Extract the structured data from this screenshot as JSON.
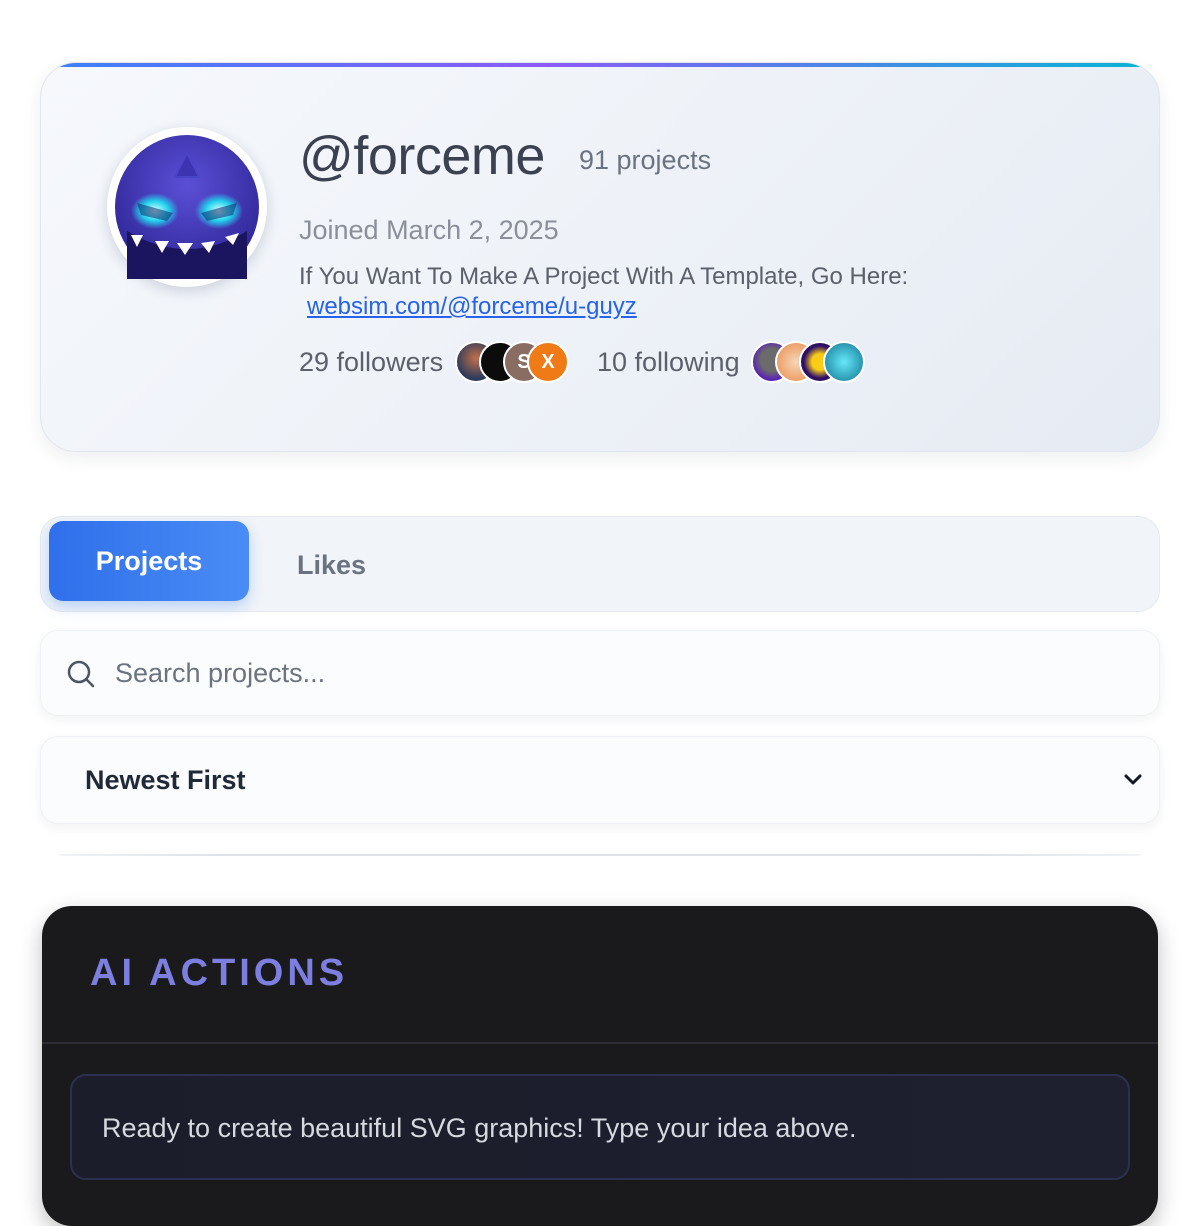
{
  "profile": {
    "username": "@forceme",
    "project_count": "91 projects",
    "joined": "Joined March 2, 2025",
    "bio": "If You Want To Make A Project With A Template, Go Here:",
    "bio_link": "websim.com/@forceme/u-guyz",
    "followers": "29 followers",
    "following": "10 following",
    "follower_avatars": [
      "avatar-photo",
      "avatar-dark",
      "avatar-s",
      "avatar-x"
    ],
    "following_avatars": [
      "avatar-purple",
      "avatar-peach",
      "avatar-yellow",
      "avatar-teal"
    ]
  },
  "tabs": [
    {
      "label": "Projects",
      "active": true
    },
    {
      "label": "Likes",
      "active": false
    }
  ],
  "search": {
    "placeholder": "Search projects...",
    "value": ""
  },
  "sort": {
    "selected": "Newest First"
  },
  "ai_actions": {
    "title": "AI ACTIONS",
    "status": "Ready to create beautiful SVG graphics! Type your idea above."
  },
  "colors": {
    "accent": "#3b82f6",
    "ai_title": "#7c7fe0",
    "link": "#2563eb",
    "panel_dark": "#1a1a1c"
  }
}
